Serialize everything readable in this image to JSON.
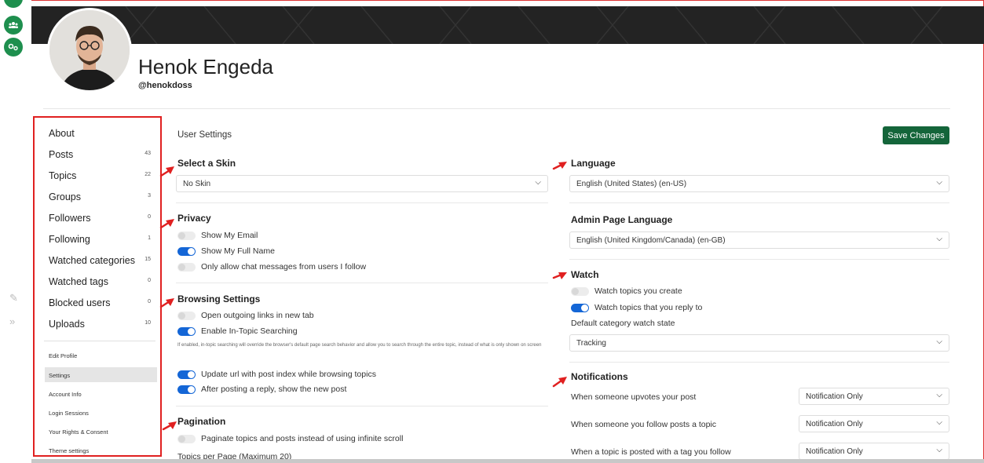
{
  "profile": {
    "name": "Henok Engeda",
    "handle": "@henokdoss"
  },
  "sidebar": {
    "items": [
      {
        "label": "About",
        "count": ""
      },
      {
        "label": "Posts",
        "count": "43"
      },
      {
        "label": "Topics",
        "count": "22"
      },
      {
        "label": "Groups",
        "count": "3"
      },
      {
        "label": "Followers",
        "count": "0"
      },
      {
        "label": "Following",
        "count": "1"
      },
      {
        "label": "Watched categories",
        "count": "15"
      },
      {
        "label": "Watched tags",
        "count": "0"
      },
      {
        "label": "Blocked users",
        "count": "0"
      },
      {
        "label": "Uploads",
        "count": "10"
      }
    ],
    "links": [
      "Edit Profile",
      "Settings",
      "Account Info",
      "Login Sessions",
      "Your Rights & Consent",
      "Theme settings"
    ]
  },
  "page_title": "User Settings",
  "save_label": "Save Changes",
  "skin": {
    "title": "Select a Skin",
    "value": "No Skin"
  },
  "privacy": {
    "title": "Privacy",
    "toggles": [
      {
        "label": "Show My Email",
        "on": false
      },
      {
        "label": "Show My Full Name",
        "on": true
      },
      {
        "label": "Only allow chat messages from users I follow",
        "on": false
      }
    ]
  },
  "browsing": {
    "title": "Browsing Settings",
    "toggles": [
      {
        "label": "Open outgoing links in new tab",
        "on": false
      },
      {
        "label": "Enable In-Topic Searching",
        "on": true
      },
      {
        "label": "Update url with post index while browsing topics",
        "on": true
      },
      {
        "label": "After posting a reply, show the new post",
        "on": true
      }
    ],
    "help": "If enabled, in-topic searching will override the browser's default page search behavior and allow you to search through the entire topic, instead of what is only shown on screen"
  },
  "pagination": {
    "title": "Pagination",
    "toggle": {
      "label": "Paginate topics and posts instead of using infinite scroll",
      "on": false
    },
    "topics_per_page": "Topics per Page (Maximum 20)"
  },
  "language": {
    "title": "Language",
    "value": "English (United States) (en-US)"
  },
  "admin_language": {
    "title": "Admin Page Language",
    "value": "English (United Kingdom/Canada) (en-GB)"
  },
  "watch": {
    "title": "Watch",
    "toggles": [
      {
        "label": "Watch topics you create",
        "on": false
      },
      {
        "label": "Watch topics that you reply to",
        "on": true
      }
    ],
    "default_label": "Default category watch state",
    "default_value": "Tracking"
  },
  "notifications": {
    "title": "Notifications",
    "rows": [
      {
        "label": "When someone upvotes your post",
        "value": "Notification Only"
      },
      {
        "label": "When someone you follow posts a topic",
        "value": "Notification Only"
      },
      {
        "label": "When a topic is posted with a tag you follow",
        "value": "Notification Only"
      }
    ]
  },
  "colors": {
    "accent": "#1466d6",
    "save": "#14653a",
    "annotation": "#e02020"
  }
}
